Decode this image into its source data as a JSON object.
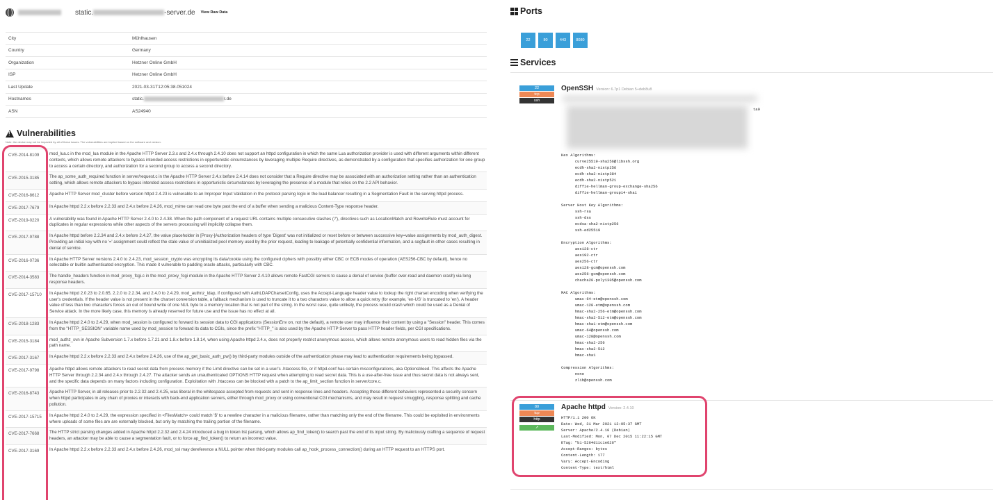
{
  "header": {
    "host_prefix": "static.",
    "host_suffix": "-server.de",
    "raw_link": "View Raw Data"
  },
  "info": [
    {
      "label": "City",
      "value": "Mühlhausen"
    },
    {
      "label": "Country",
      "value": "Germany"
    },
    {
      "label": "Organization",
      "value": "Hetzner Online GmbH"
    },
    {
      "label": "ISP",
      "value": "Hetzner Online GmbH"
    },
    {
      "label": "Last Update",
      "value": "2021-03-31T12:05:38.051024"
    },
    {
      "label": "Hostnames",
      "value": "static.",
      "value_suffix": "r.de"
    },
    {
      "label": "ASN",
      "value": "AS24940"
    }
  ],
  "vulns_title": "Vulnerabilities",
  "vulns_note": "Note: the device may not be impacted by all of these issues. The vulnerabilities are implied based on the software and version.",
  "vulns": [
    {
      "cve": "CVE-2014-8109",
      "desc": "mod_lua.c in the mod_lua module in the Apache HTTP Server 2.3.x and 2.4.x through 2.4.10 does not support an httpd configuration in which the same Lua authorization provider is used with different arguments within different contexts, which allows remote attackers to bypass intended access restrictions in opportunistic circumstances by leveraging multiple Require directives, as demonstrated by a configuration that specifies authorization for one group to access a certain directory, and authorization for a second group to access a second directory."
    },
    {
      "cve": "CVE-2015-3185",
      "desc": "The ap_some_auth_required function in server/request.c in the Apache HTTP Server 2.4.x before 2.4.14 does not consider that a Require directive may be associated with an authorization setting rather than an authentication setting, which allows remote attackers to bypass intended access restrictions in opportunistic circumstances by leveraging the presence of a module that relies on the 2.2 API behavior."
    },
    {
      "cve": "CVE-2016-8612",
      "desc": "Apache HTTP Server mod_cluster before version httpd 2.4.23 is vulnerable to an Improper Input Validation in the protocol parsing logic in the load balancer resulting in a Segmentation Fault in the serving httpd process."
    },
    {
      "cve": "CVE-2017-7679",
      "desc": "In Apache httpd 2.2.x before 2.2.33 and 2.4.x before 2.4.26, mod_mime can read one byte past the end of a buffer when sending a malicious Content-Type response header."
    },
    {
      "cve": "CVE-2019-0220",
      "desc": "A vulnerability was found in Apache HTTP Server 2.4.0 to 2.4.38. When the path component of a request URL contains multiple consecutive slashes ('/'), directives such as LocationMatch and RewriteRule must account for duplicates in regular expressions while other aspects of the servers processing will implicitly collapse them."
    },
    {
      "cve": "CVE-2017-9788",
      "desc": "In Apache httpd before 2.2.34 and 2.4.x before 2.4.27, the value placeholder in [Proxy-]Authorization headers of type 'Digest' was not initialized or reset before or between successive key=value assignments by mod_auth_digest. Providing an initial key with no '=' assignment could reflect the stale value of uninitialized pool memory used by the prior request, leading to leakage of potentially confidential information, and a segfault in other cases resulting in denial of service."
    },
    {
      "cve": "CVE-2016-0736",
      "desc": "In Apache HTTP Server versions 2.4.0 to 2.4.23, mod_session_crypto was encrypting its data/cookie using the configured ciphers with possibly either CBC or ECB modes of operation (AES256-CBC by default), hence no selectable or builtin authenticated encryption. This made it vulnerable to padding oracle attacks, particularly with CBC."
    },
    {
      "cve": "CVE-2014-3583",
      "desc": "The handle_headers function in mod_proxy_fcgi.c in the mod_proxy_fcgi module in the Apache HTTP Server 2.4.10 allows remote FastCGI servers to cause a denial of service (buffer over-read and daemon crash) via long response headers."
    },
    {
      "cve": "CVE-2017-15710",
      "desc": "In Apache httpd 2.0.23 to 2.0.65, 2.2.0 to 2.2.34, and 2.4.0 to 2.4.29, mod_authnz_ldap, if configured with AuthLDAPCharsetConfig, uses the Accept-Language header value to lookup the right charset encoding when verifying the user's credentials. If the header value is not present in the charset conversion table, a fallback mechanism is used to truncate it to a two characters value to allow a quick retry (for example, 'en-US' is truncated to 'en'). A header value of less than two characters forces an out of bound write of one NUL byte to a memory location that is not part of the string. In the worst case, quite unlikely, the process would crash which could be used as a Denial of Service attack. In the more likely case, this memory is already reserved for future use and the issue has no effect at all."
    },
    {
      "cve": "CVE-2018-1283",
      "desc": "In Apache httpd 2.4.0 to 2.4.29, when mod_session is configured to forward its session data to CGI applications (SessionEnv on, not the default), a remote user may influence their content by using a \"Session\" header. This comes from the \"HTTP_SESSION\" variable name used by mod_session to forward its data to CGIs, since the prefix \"HTTP_\" is also used by the Apache HTTP Server to pass HTTP header fields, per CGI specifications."
    },
    {
      "cve": "CVE-2015-3184",
      "desc": "mod_authz_svn in Apache Subversion 1.7.x before 1.7.21 and 1.8.x before 1.8.14, when using Apache httpd 2.4.x, does not properly restrict anonymous access, which allows remote anonymous users to read hidden files via the path name."
    },
    {
      "cve": "CVE-2017-3167",
      "desc": "In Apache httpd 2.2.x before 2.2.33 and 2.4.x before 2.4.26, use of the ap_get_basic_auth_pw() by third-party modules outside of the authentication phase may lead to authentication requirements being bypassed."
    },
    {
      "cve": "CVE-2017-9798",
      "desc": "Apache httpd allows remote attackers to read secret data from process memory if the Limit directive can be set in a user's .htaccess file, or if httpd.conf has certain misconfigurations, aka Optionsbleed. This affects the Apache HTTP Server through 2.2.34 and 2.4.x through 2.4.27. The attacker sends an unauthenticated OPTIONS HTTP request when attempting to read secret data. This is a use-after-free issue and thus secret data is not always sent, and the specific data depends on many factors including configuration. Exploitation with .htaccess can be blocked with a patch to the ap_limit_section function in server/core.c."
    },
    {
      "cve": "CVE-2016-8743",
      "desc": "Apache HTTP Server, in all releases prior to 2.2.32 and 2.4.25, was liberal in the whitespace accepted from requests and sent in response lines and headers. Accepting these different behaviors represented a security concern when httpd participates in any chain of proxies or interacts with back-end application servers, either through mod_proxy or using conventional CGI mechanisms, and may result in request smuggling, response splitting and cache pollution."
    },
    {
      "cve": "CVE-2017-15715",
      "desc": "In Apache httpd 2.4.0 to 2.4.29, the expression specified in <FilesMatch> could match '$' to a newline character in a malicious filename, rather than matching only the end of the filename. This could be exploited in environments where uploads of some files are are externally blocked, but only by matching the trailing portion of the filename."
    },
    {
      "cve": "CVE-2017-7668",
      "desc": "The HTTP strict parsing changes added in Apache httpd 2.2.32 and 2.4.24 introduced a bug in token list parsing, which allows ap_find_token() to search past the end of its input string. By maliciously crafting a sequence of request headers, an attacker may be able to cause a segmentation fault, or to force ap_find_token() to return an incorrect value."
    },
    {
      "cve": "CVE-2017-3169",
      "desc": "In Apache httpd 2.2.x before 2.2.33 and 2.4.x before 2.4.26, mod_ssl may dereference a NULL pointer when third-party modules call ap_hook_process_connection() during an HTTP request to an HTTPS port."
    }
  ],
  "ports_title": "Ports",
  "ports": [
    "22",
    "80",
    "443",
    "8080"
  ],
  "services_title": "Services",
  "ssh": {
    "port": "22",
    "proto": "tcp",
    "name": "ssh",
    "product": "OpenSSH",
    "version": "Version: 6.7p1 Debian 5+deb8u8",
    "partial": "ta0",
    "algos": "Kex Algorithms:\n\tcurve25519-sha256@libssh.org\n\tecdh-sha2-nistp256\n\tecdh-sha2-nistp384\n\tecdh-sha2-nistp521\n\tdiffie-hellman-group-exchange-sha256\n\tdiffie-hellman-group14-sha1\n\nServer Host Key Algorithms:\n\tssh-rsa\n\tssh-dss\n\tecdsa-sha2-nistp256\n\tssh-ed25519\n\nEncryption Algorithms:\n\taes128-ctr\n\taes192-ctr\n\taes256-ctr\n\taes128-gcm@openssh.com\n\taes256-gcm@openssh.com\n\tchacha20-poly1305@openssh.com\n\nMAC Algorithms:\n\tumac-64-etm@openssh.com\n\tumac-128-etm@openssh.com\n\thmac-sha2-256-etm@openssh.com\n\thmac-sha2-512-etm@openssh.com\n\thmac-sha1-etm@openssh.com\n\tumac-64@openssh.com\n\tumac-128@openssh.com\n\thmac-sha2-256\n\thmac-sha2-512\n\thmac-sha1\n\nCompression Algorithms:\n\tnone\n\tzlib@openssh.com"
  },
  "http": {
    "port": "80",
    "proto": "tcp",
    "name": "http",
    "link_icon": "↗",
    "product": "Apache httpd",
    "version": "Version: 2.4.10",
    "response": "HTTP/1.1 200 OK\nDate: Wed, 31 Mar 2021 12:05:37 GMT\nServer: Apache/2.4.10 (Debian)\nLast-Modified: Mon, 07 Dec 2015 11:22:15 GMT\nETag: \"b1-5264d11c1e626\"\nAccept-Ranges: bytes\nContent-Length: 177\nVary: Accept-Encoding\nContent-Type: text/html"
  },
  "colors": {
    "highlight": "#e0446e",
    "port_blue": "#3a9fd9",
    "proto_orange": "#ee8855",
    "name_dark": "#333333",
    "link_green": "#5cb85c"
  }
}
